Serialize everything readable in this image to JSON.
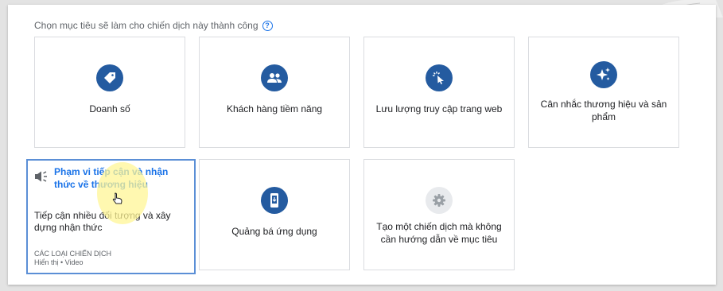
{
  "heading": {
    "text": "Chọn mục tiêu sẽ làm cho chiến dịch này thành công",
    "help_icon": "help-circle-icon"
  },
  "goals": [
    {
      "label": "Doanh số",
      "icon": "tag-icon"
    },
    {
      "label": "Khách hàng tiềm năng",
      "icon": "people-icon"
    },
    {
      "label": "Lưu lượng truy cập trang web",
      "icon": "cursor-click-icon"
    },
    {
      "label": "Cân nhắc thương hiệu và sản phẩm",
      "icon": "sparkle-icon"
    },
    {
      "label": "Quảng bá ứng dụng",
      "icon": "mobile-app-icon"
    },
    {
      "label": "Tạo một chiến dịch mà không cần hướng dẫn về mục tiêu",
      "icon": "gear-icon"
    }
  ],
  "selected_goal": {
    "title": "Phạm vi tiếp cận và nhận thức về thương hiệu",
    "description": "Tiếp cận nhiều đối tượng và xây dựng nhận thức",
    "types_label": "CÁC LOẠI CHIẾN DỊCH",
    "types_value": "Hiển thị • Video",
    "icon": "megaphone-icon"
  },
  "colors": {
    "icon_bg": "#245ba0",
    "selected_border": "#5b8fd6",
    "selected_title": "#1a73e8",
    "annotation_arrow": "#e8201a"
  }
}
